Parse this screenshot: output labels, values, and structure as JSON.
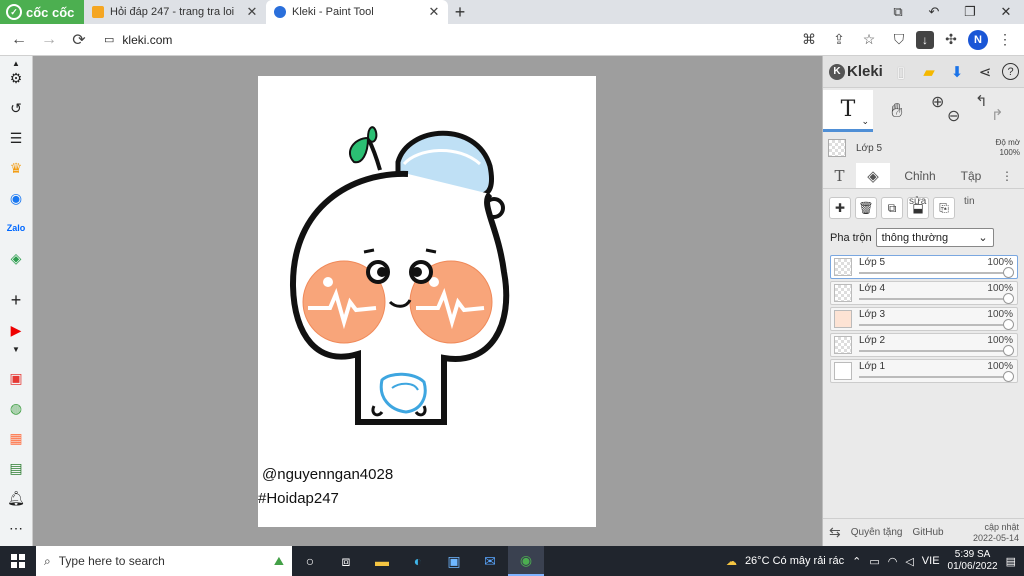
{
  "browser": {
    "logo_text": "cốc cốc",
    "tabs": [
      {
        "title": "Hỏi đáp 247 - trang tra loi",
        "active": false
      },
      {
        "title": "Kleki - Paint Tool",
        "active": true
      }
    ],
    "url": "kleki.com",
    "profile_initial": "N"
  },
  "canvas": {
    "watermark_1": "@nguyenngan4028",
    "watermark_2": "#Hoidap247"
  },
  "panel": {
    "logo": "Kleki",
    "current_layer": "Lớp 5",
    "opacity_label": "Độ mờ",
    "opacity_value": "100%",
    "tabs": [
      "Chỉnh",
      "Tập"
    ],
    "tool_notes": [
      "sửa",
      "tin"
    ],
    "blend_label": "Pha trộn",
    "blend_value": "thông thường",
    "layers": [
      {
        "name": "Lớp 5",
        "opacity": "100%",
        "active": true
      },
      {
        "name": "Lớp 4",
        "opacity": "100%",
        "active": false
      },
      {
        "name": "Lớp 3",
        "opacity": "100%",
        "active": false
      },
      {
        "name": "Lớp 2",
        "opacity": "100%",
        "active": false
      },
      {
        "name": "Lớp 1",
        "opacity": "100%",
        "active": false
      }
    ],
    "footer": {
      "donate": "Quyên tặng",
      "github": "GitHub",
      "update_label": "cập nhật",
      "update_date": "2022-05-14"
    }
  },
  "taskbar": {
    "search_placeholder": "Type here to search",
    "weather": "26°C  Có mây rải rác",
    "lang": "VIE",
    "time": "5:39 SA",
    "date": "01/06/2022"
  },
  "colors": {
    "browser_green": "#4caf50",
    "accent_blue": "#4f8fd6",
    "canvas_bg": "#9e9e9e",
    "cheek": "#f8a57a",
    "hat": "#bfe0f5",
    "sprout": "#2bbf73"
  }
}
